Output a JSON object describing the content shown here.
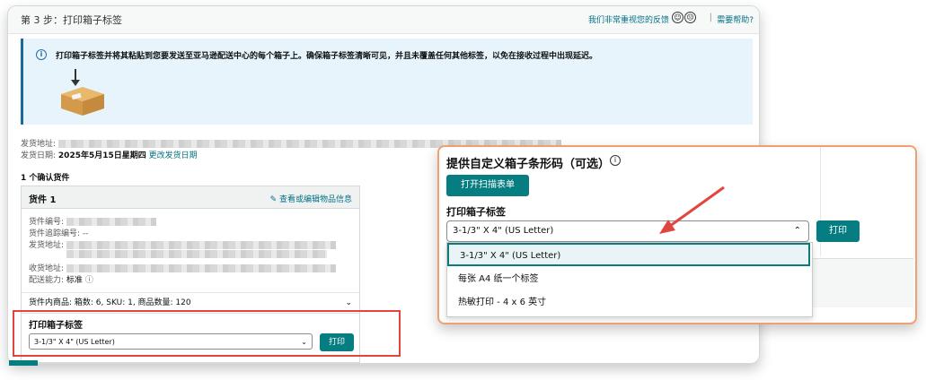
{
  "header": {
    "step_title": "第 3 步：打印箱子标签",
    "feedback": "我们非常重视您的反馈",
    "happy_face": "☺",
    "sad_face": "☹",
    "separator": "|",
    "help": "需要帮助?"
  },
  "info": {
    "text": "打印箱子标签并将其粘贴到您要发送至亚马逊配送中心的每个箱子上。确保箱子标签清晰可见，并且未覆盖任何其他标签，以免在接收过程中出现延迟。"
  },
  "shipping": {
    "from_label": "发货地址:",
    "date_label": "发货日期:",
    "date_value": "2025年5月15日星期四",
    "change_date": "更改发货日期"
  },
  "confirmed_title": "1 个确认货件",
  "shipment": {
    "title": "货件 1",
    "edit_link": "查看或编辑物品信息",
    "id_label": "货件编号:",
    "tracking_label": "货件追踪编号: --",
    "ship_from_label": "发货地址:",
    "ship_to_label": "收货地址:",
    "capability_label": "配送能力:",
    "capability_value": "标准",
    "items_summary": "货件内商品: 箱数: 6, SKU: 1, 商品数量: 120",
    "print_title": "打印箱子标签",
    "select_value": "3-1/3\" X 4\" (US Letter)",
    "print_btn": "打印"
  },
  "modal": {
    "title": "提供自定义箱子条形码（可选）",
    "scan_btn": "打开扫描表单",
    "print_label": "打印箱子标签",
    "select_value": "3-1/3\" X 4\" (US Letter)",
    "print_btn": "打印",
    "options": [
      "3-1/3\" X 4\" (US Letter)",
      "每张 A4 纸一个标签",
      "热敏打印 - 4 x 6 英寸"
    ]
  },
  "colors": {
    "teal": "#067d80",
    "link": "#007185",
    "highlight_red": "#e0463d",
    "modal_border": "#f0a070"
  }
}
